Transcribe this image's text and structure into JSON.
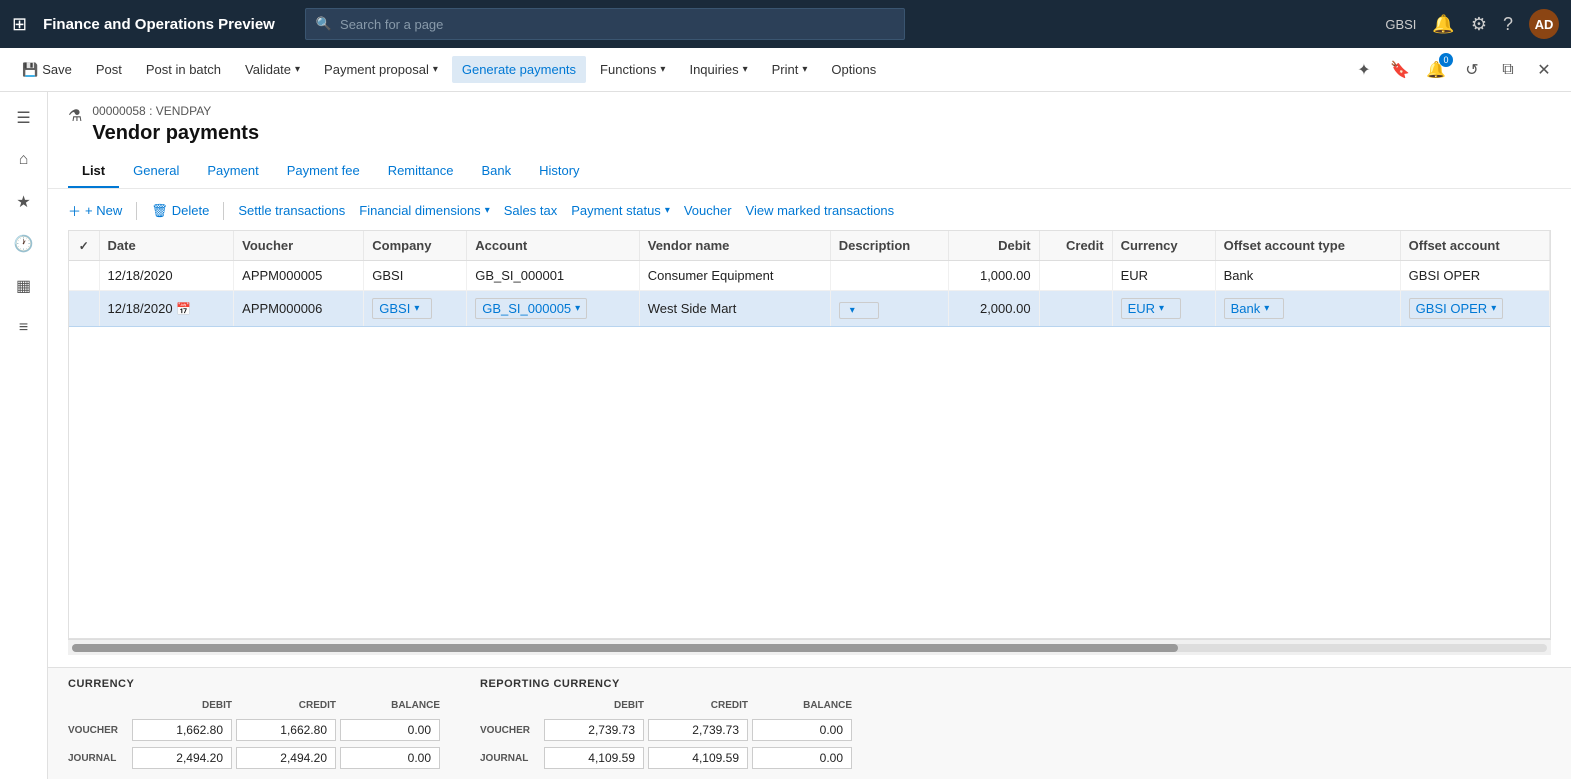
{
  "topBar": {
    "appTitle": "Finance and Operations Preview",
    "searchPlaceholder": "Search for a page",
    "userInitials": "AD",
    "userCode": "GBSI"
  },
  "commandBar": {
    "buttons": [
      {
        "id": "save",
        "label": "Save",
        "icon": "💾",
        "hasDropdown": false
      },
      {
        "id": "post",
        "label": "Post",
        "icon": "",
        "hasDropdown": false
      },
      {
        "id": "post-in-batch",
        "label": "Post in batch",
        "icon": "",
        "hasDropdown": false
      },
      {
        "id": "validate",
        "label": "Validate",
        "icon": "",
        "hasDropdown": true
      },
      {
        "id": "payment-proposal",
        "label": "Payment proposal",
        "icon": "",
        "hasDropdown": true
      },
      {
        "id": "generate-payments",
        "label": "Generate payments",
        "icon": "",
        "hasDropdown": false,
        "active": true
      },
      {
        "id": "functions",
        "label": "Functions",
        "icon": "",
        "hasDropdown": true
      },
      {
        "id": "inquiries",
        "label": "Inquiries",
        "icon": "",
        "hasDropdown": true
      },
      {
        "id": "print",
        "label": "Print",
        "icon": "",
        "hasDropdown": true
      },
      {
        "id": "options",
        "label": "Options",
        "icon": "",
        "hasDropdown": false
      }
    ]
  },
  "breadcrumb": "00000058 : VENDPAY",
  "pageTitle": "Vendor payments",
  "tabs": [
    {
      "id": "list",
      "label": "List",
      "active": true
    },
    {
      "id": "general",
      "label": "General"
    },
    {
      "id": "payment",
      "label": "Payment"
    },
    {
      "id": "payment-fee",
      "label": "Payment fee"
    },
    {
      "id": "remittance",
      "label": "Remittance"
    },
    {
      "id": "bank",
      "label": "Bank"
    },
    {
      "id": "history",
      "label": "History"
    }
  ],
  "toolbar": {
    "new": "+ New",
    "delete": "Delete",
    "settleTransactions": "Settle transactions",
    "financialDimensions": "Financial dimensions",
    "salesTax": "Sales tax",
    "paymentStatus": "Payment status",
    "voucher": "Voucher",
    "viewMarkedTransactions": "View marked transactions"
  },
  "tableColumns": [
    {
      "id": "check",
      "label": ""
    },
    {
      "id": "date",
      "label": "Date"
    },
    {
      "id": "voucher",
      "label": "Voucher"
    },
    {
      "id": "company",
      "label": "Company"
    },
    {
      "id": "account",
      "label": "Account"
    },
    {
      "id": "vendorName",
      "label": "Vendor name"
    },
    {
      "id": "description",
      "label": "Description"
    },
    {
      "id": "debit",
      "label": "Debit",
      "align": "right"
    },
    {
      "id": "credit",
      "label": "Credit",
      "align": "right"
    },
    {
      "id": "currency",
      "label": "Currency"
    },
    {
      "id": "offsetAccountType",
      "label": "Offset account type"
    },
    {
      "id": "offsetAccount",
      "label": "Offset account"
    }
  ],
  "tableRows": [
    {
      "id": "row1",
      "selected": false,
      "date": "12/18/2020",
      "voucher": "APPM000005",
      "company": "GBSI",
      "account": "GB_SI_000001",
      "vendorName": "Consumer Equipment",
      "description": "",
      "debit": "1,000.00",
      "credit": "",
      "currency": "EUR",
      "offsetAccountType": "Bank",
      "offsetAccount": "GBSI OPER"
    },
    {
      "id": "row2",
      "selected": true,
      "date": "12/18/2020",
      "voucher": "APPM000006",
      "company": "GBSI",
      "account": "GB_SI_000005",
      "vendorName": "West Side Mart",
      "description": "",
      "debit": "2,000.00",
      "credit": "",
      "currency": "EUR",
      "offsetAccountType": "Bank",
      "offsetAccount": "GBSI OPER"
    }
  ],
  "summary": {
    "currencySection": {
      "title": "CURRENCY",
      "columns": [
        "DEBIT",
        "CREDIT",
        "BALANCE"
      ],
      "rows": [
        {
          "label": "VOUCHER",
          "debit": "1,662.80",
          "credit": "1,662.80",
          "balance": "0.00"
        },
        {
          "label": "JOURNAL",
          "debit": "2,494.20",
          "credit": "2,494.20",
          "balance": "0.00"
        }
      ]
    },
    "reportingCurrencySection": {
      "title": "REPORTING CURRENCY",
      "columns": [
        "DEBIT",
        "CREDIT",
        "BALANCE"
      ],
      "rows": [
        {
          "label": "VOUCHER",
          "debit": "2,739.73",
          "credit": "2,739.73",
          "balance": "0.00"
        },
        {
          "label": "JOURNAL",
          "debit": "4,109.59",
          "credit": "4,109.59",
          "balance": "0.00"
        }
      ]
    }
  }
}
